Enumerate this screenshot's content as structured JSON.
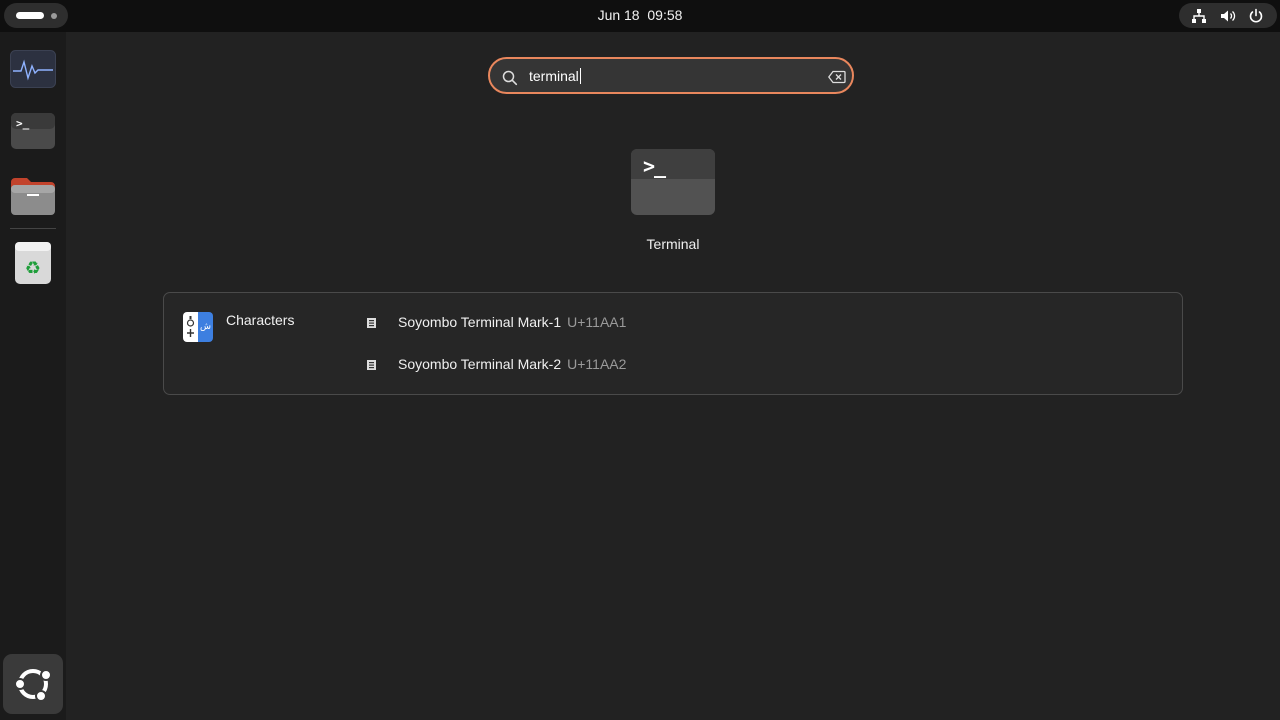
{
  "topbar": {
    "clock": "Jun 18  09:58",
    "tray_icons": [
      "network-icon",
      "volume-icon",
      "power-icon"
    ]
  },
  "dock": {
    "items": [
      {
        "name": "System Monitor",
        "icon": "system-monitor-icon"
      },
      {
        "name": "Terminal",
        "icon": "terminal-icon"
      },
      {
        "name": "Files",
        "icon": "files-icon"
      },
      {
        "name": "Trash",
        "icon": "trash-icon"
      }
    ],
    "apps_button_icon": "ubuntu-logo-icon"
  },
  "search": {
    "value": "terminal",
    "icon": "search-icon",
    "clear_icon": "clear-text-icon",
    "accent": "#e9875d"
  },
  "app_results": [
    {
      "label": "Terminal",
      "icon": "terminal-icon"
    }
  ],
  "character_results": {
    "provider_name": "Characters",
    "provider_icon": "characters-app-icon",
    "items": [
      {
        "name": "Soyombo Terminal Mark-1",
        "code": "U+11AA1"
      },
      {
        "name": "Soyombo Terminal Mark-2",
        "code": "U+11AA2"
      }
    ]
  }
}
